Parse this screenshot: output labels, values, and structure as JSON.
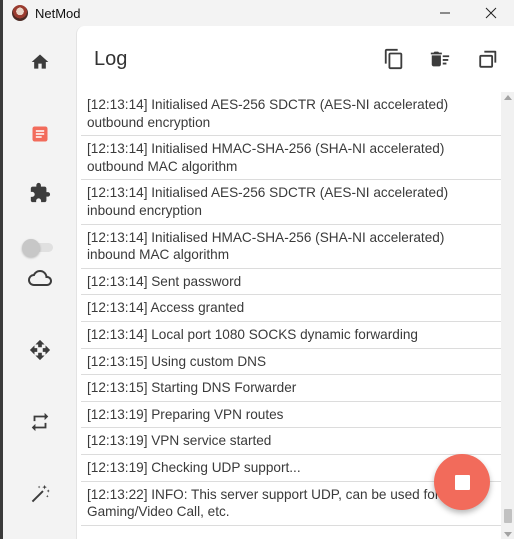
{
  "window": {
    "title": "NetMod",
    "minimize_glyph": "—",
    "close_glyph": "✕"
  },
  "sidebar": {
    "items": [
      {
        "name": "home",
        "icon": "home-icon",
        "active": false
      },
      {
        "name": "log",
        "icon": "log-icon",
        "active": true,
        "color": "#f26b5b"
      },
      {
        "name": "extensions",
        "icon": "puzzle-icon",
        "active": false
      },
      {
        "name": "cloud",
        "icon": "cloud-icon",
        "active": false
      },
      {
        "name": "move",
        "icon": "move-icon",
        "active": false
      },
      {
        "name": "transfer",
        "icon": "repeat-icon",
        "active": false
      },
      {
        "name": "tools",
        "icon": "magic-wand-icon",
        "active": false
      }
    ],
    "toggle": {
      "state": "off"
    }
  },
  "header": {
    "title": "Log",
    "actions": [
      {
        "name": "copy",
        "icon": "copy-icon"
      },
      {
        "name": "clear",
        "icon": "clear-all-icon"
      },
      {
        "name": "window",
        "icon": "window-icon"
      }
    ]
  },
  "log": {
    "entries": [
      "[12:13:14] Initialised AES-256 SDCTR (AES-NI accelerated) outbound encryption",
      "[12:13:14] Initialised HMAC-SHA-256 (SHA-NI accelerated) outbound MAC algorithm",
      "[12:13:14] Initialised AES-256 SDCTR (AES-NI accelerated) inbound encryption",
      "[12:13:14] Initialised HMAC-SHA-256 (SHA-NI accelerated) inbound MAC algorithm",
      "[12:13:14] Sent password",
      "[12:13:14] Access granted",
      "[12:13:14] Local port 1080 SOCKS dynamic forwarding",
      "[12:13:15] Using custom DNS",
      "[12:13:15] Starting DNS Forwarder",
      "[12:13:19] Preparing VPN routes",
      "[12:13:19] VPN service started",
      "[12:13:19] Checking UDP support...",
      "[12:13:22] INFO: This server support UDP, can be used for Gaming/Video Call, etc."
    ]
  },
  "fab": {
    "action": "stop",
    "icon": "stop-icon",
    "color": "#f26b5b"
  }
}
